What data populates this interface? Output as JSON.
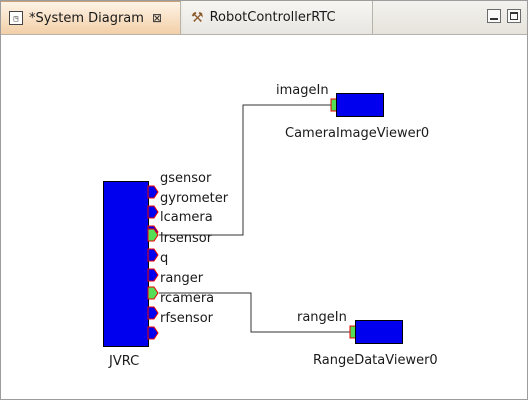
{
  "tabs": [
    {
      "label": "*System Diagram",
      "icon": "diagram-icon",
      "close_glyph": "⊠",
      "active": true
    },
    {
      "label": "RobotControllerRTC",
      "icon": "hammer-icon",
      "active": false
    }
  ],
  "window_buttons": [
    "minimize-icon",
    "maximize-icon"
  ],
  "diagram": {
    "components": [
      {
        "name": "JVRC",
        "color": "#0000ee"
      },
      {
        "name": "CameraImageViewer0",
        "color": "#0000ee"
      },
      {
        "name": "RangeDataViewer0",
        "color": "#0000ee"
      }
    ],
    "jvrc_ports": [
      "gsensor",
      "gyrometer",
      "lcamera",
      "lrsensor",
      "q",
      "ranger",
      "rcamera",
      "rfsensor"
    ],
    "camera_inport": "imageIn",
    "range_inport": "rangeIn",
    "connections": [
      {
        "from": "lrsensor",
        "to": "imageIn"
      },
      {
        "from": "rcamera",
        "to": "rangeIn"
      }
    ],
    "colors": {
      "outport_fill": "#0000ee",
      "outport_edge": "#ee0000",
      "connected_port_fill": "#55dd55",
      "wire": "#333333"
    }
  }
}
